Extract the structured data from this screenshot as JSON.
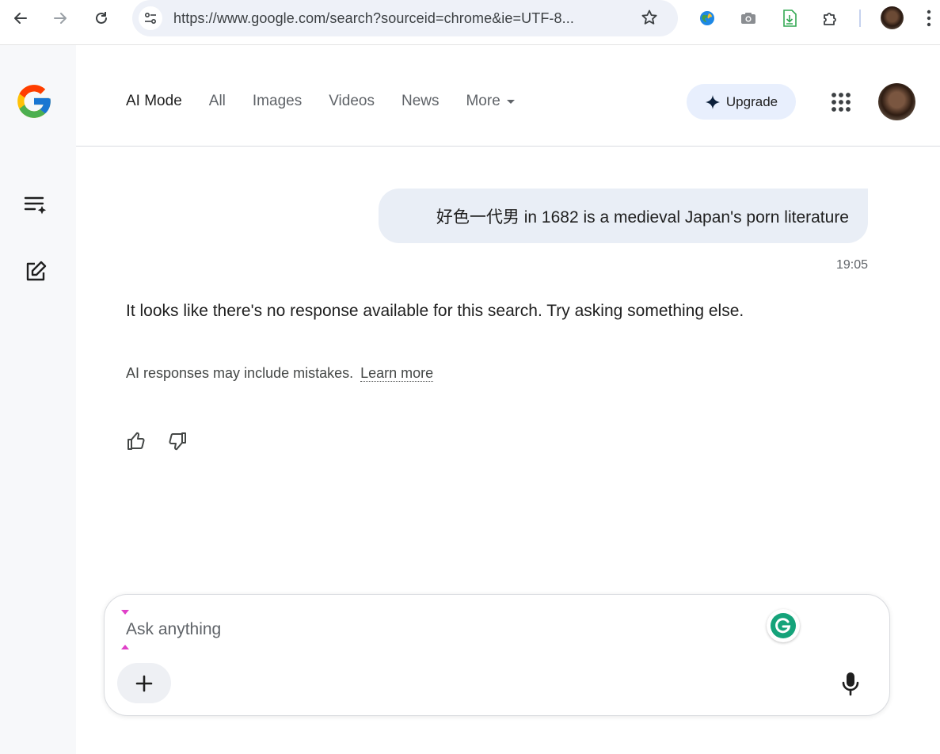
{
  "browser": {
    "url": "https://www.google.com/search?sourceid=chrome&ie=UTF-8...",
    "icons": [
      "back-icon",
      "forward-icon",
      "reload-icon",
      "site-settings-icon",
      "star-icon",
      "earth-extension-icon",
      "camera-icon",
      "download-doc-icon",
      "extensions-icon",
      "profile-avatar",
      "more-vert-icon"
    ]
  },
  "header": {
    "tabs": [
      {
        "label": "AI Mode",
        "active": true
      },
      {
        "label": "All"
      },
      {
        "label": "Images"
      },
      {
        "label": "Videos"
      },
      {
        "label": "News"
      },
      {
        "label": "More"
      }
    ],
    "upgrade_label": "Upgrade"
  },
  "conversation": {
    "user_message": "好色一代男 in 1682 is a medieval Japan's porn literature",
    "timestamp": "19:05",
    "answer": "It looks like there's no response available for this search. Try asking something else.",
    "disclaimer": "AI responses may include mistakes.",
    "learn_more": "Learn more"
  },
  "input": {
    "placeholder": "Ask anything"
  },
  "colors": {
    "accent_blue": "#1a73e8",
    "upgrade_bg": "#e8effd",
    "bubble_bg": "#e9eef6",
    "rail_bg": "#f7f8fa"
  }
}
